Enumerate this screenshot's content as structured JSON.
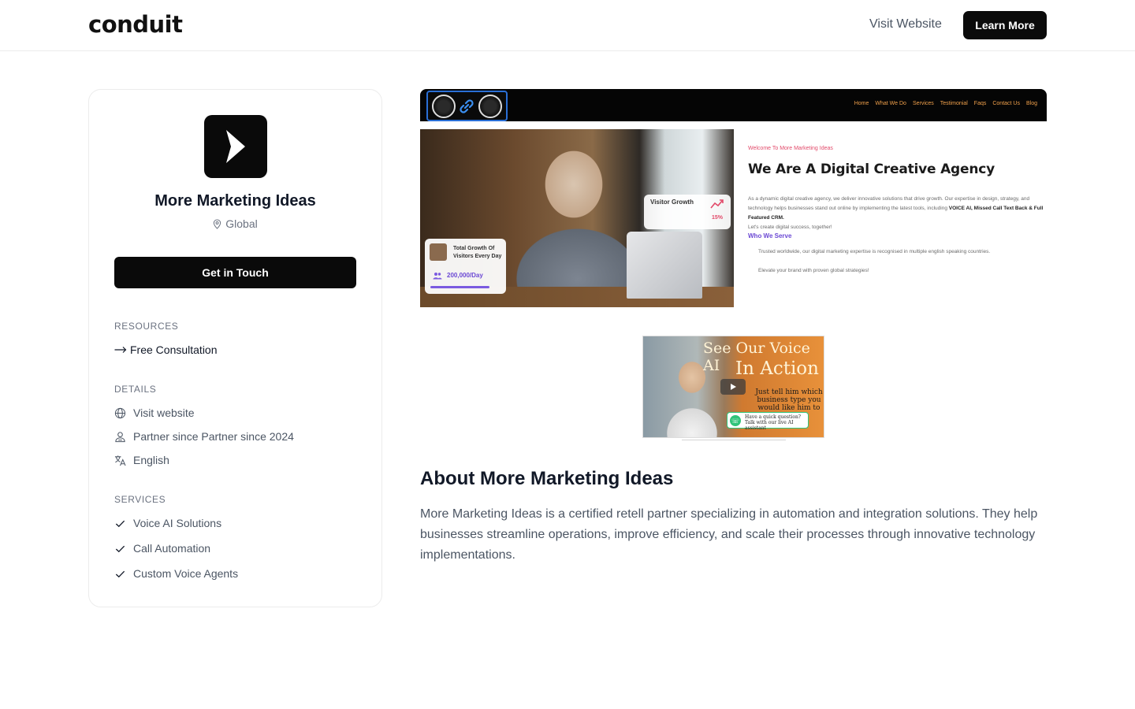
{
  "header": {
    "logo": "conduit",
    "visit_label": "Visit Website",
    "learn_label": "Learn More"
  },
  "partner": {
    "name": "More Marketing Ideas",
    "location": "Global",
    "cta_label": "Get in Touch"
  },
  "resources": {
    "heading": "RESOURCES",
    "items": [
      {
        "label": "Free Consultation",
        "icon": "arrow-right-icon"
      }
    ]
  },
  "details": {
    "heading": "DETAILS",
    "items": [
      {
        "label": "Visit website",
        "icon": "globe-icon"
      },
      {
        "label": "Partner since Partner since 2024",
        "icon": "users-icon"
      },
      {
        "label": "English",
        "icon": "translate-icon"
      }
    ]
  },
  "services": {
    "heading": "SERVICES",
    "items": [
      {
        "label": "Voice AI Solutions",
        "icon": "check-icon"
      },
      {
        "label": "Call Automation",
        "icon": "check-icon"
      },
      {
        "label": "Custom Voice Agents",
        "icon": "check-icon"
      }
    ]
  },
  "preview": {
    "nav": [
      "Home",
      "What We Do",
      "Services",
      "Testimonial",
      "Faqs",
      "Contact Us",
      "Blog"
    ],
    "welcome": "Welcome To More Marketing Ideas",
    "title": "We Are A Digital Creative Agency",
    "body_1": "As a dynamic digital creative agency, we deliver innovative solutions that drive growth. Our expertise in design,",
    "body_2": "strategy, and technology helps businesses stand out online by implementing the latest tools, including",
    "body_bold": "VOICE AI, Missed Call Text Back & Full Featured CRM.",
    "body_3": "Let's create digital success, together!",
    "who": "Who We Serve",
    "trusted": "Trusted worldwide, our digital marketing expertise is recognised in multiple english speaking countries.",
    "elevate": "Elevate your brand with proven global strategies!",
    "visitor_label": "Visitor Growth",
    "visitor_pct": "15%",
    "growth_label": "Total Growth Of Visitors Every Day",
    "growth_value": "200,000/Day"
  },
  "video": {
    "line1": "See Our Voice AI",
    "line2": "In Action",
    "sub": "Just tell him which business type you would like him to",
    "chat_1": "Have a quick question?",
    "chat_2": "Talk with our live AI assistant"
  },
  "about": {
    "title": "About More Marketing Ideas",
    "body": "More Marketing Ideas is a certified retell partner specializing in automation and integration solutions. They help businesses streamline operations, improve efficiency, and scale their processes through innovative technology implementations."
  }
}
